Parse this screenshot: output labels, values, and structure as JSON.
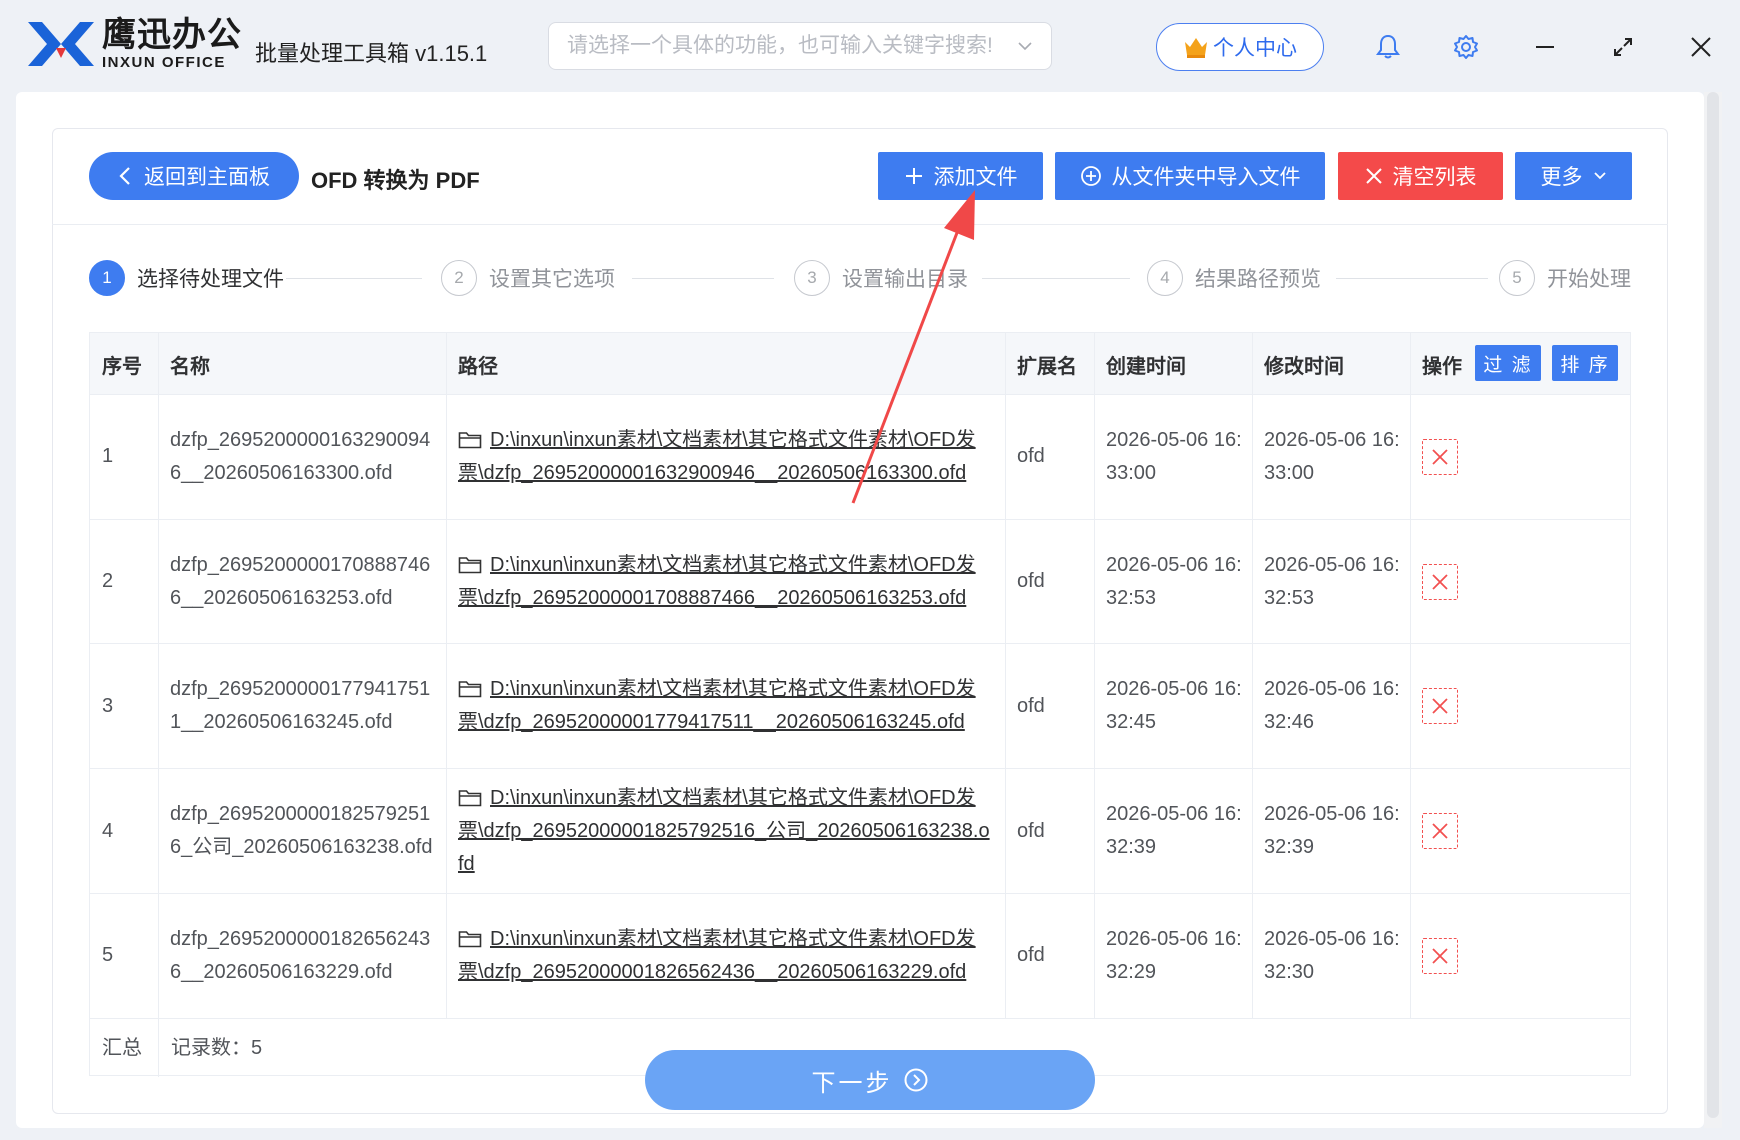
{
  "app": {
    "brand_cn": "鹰迅办公",
    "brand_en": "INXUN OFFICE",
    "title": "批量处理工具箱 v1.15.1",
    "search_placeholder": "请选择一个具体的功能，也可输入关键字搜索!",
    "user_center": "个人中心"
  },
  "toolbar": {
    "back_label": "返回到主面板",
    "page_title": "OFD 转换为 PDF",
    "add_file": "添加文件",
    "import_folder": "从文件夹中导入文件",
    "clear_list": "清空列表",
    "more": "更多"
  },
  "steps": [
    {
      "num": "1",
      "label": "选择待处理文件"
    },
    {
      "num": "2",
      "label": "设置其它选项"
    },
    {
      "num": "3",
      "label": "设置输出目录"
    },
    {
      "num": "4",
      "label": "结果路径预览"
    },
    {
      "num": "5",
      "label": "开始处理"
    }
  ],
  "table": {
    "headers": [
      "序号",
      "名称",
      "路径",
      "扩展名",
      "创建时间",
      "修改时间",
      "操作"
    ],
    "filter_label": "过 滤",
    "sort_label": "排 序",
    "rows": [
      {
        "index": "1",
        "name": "dzfp_26952000001632900946__20260506163300.ofd",
        "path": "D:\\inxun\\inxun素材\\文档素材\\其它格式文件素材\\OFD发票\\dzfp_26952000001632900946__20260506163300.ofd",
        "ext": "ofd",
        "created": "2026-05-06 16:33:00",
        "modified": "2026-05-06 16:33:00"
      },
      {
        "index": "2",
        "name": "dzfp_26952000001708887466__20260506163253.ofd",
        "path": "D:\\inxun\\inxun素材\\文档素材\\其它格式文件素材\\OFD发票\\dzfp_26952000001708887466__20260506163253.ofd",
        "ext": "ofd",
        "created": "2026-05-06 16:32:53",
        "modified": "2026-05-06 16:32:53"
      },
      {
        "index": "3",
        "name": "dzfp_26952000001779417511__20260506163245.ofd",
        "path": "D:\\inxun\\inxun素材\\文档素材\\其它格式文件素材\\OFD发票\\dzfp_26952000001779417511__20260506163245.ofd",
        "ext": "ofd",
        "created": "2026-05-06 16:32:45",
        "modified": "2026-05-06 16:32:46"
      },
      {
        "index": "4",
        "name": "dzfp_26952000001825792516_公司_20260506163238.ofd",
        "path": "D:\\inxun\\inxun素材\\文档素材\\其它格式文件素材\\OFD发票\\dzfp_26952000001825792516_公司_20260506163238.ofd",
        "ext": "ofd",
        "created": "2026-05-06 16:32:39",
        "modified": "2026-05-06 16:32:39"
      },
      {
        "index": "5",
        "name": "dzfp_26952000001826562436__20260506163229.ofd",
        "path": "D:\\inxun\\inxun素材\\文档素材\\其它格式文件素材\\OFD发票\\dzfp_26952000001826562436__20260506163229.ofd",
        "ext": "ofd",
        "created": "2026-05-06 16:32:29",
        "modified": "2026-05-06 16:32:30"
      }
    ],
    "summary_label": "汇总",
    "summary_count": "记录数：5"
  },
  "footer": {
    "next_label": "下一步"
  },
  "colors": {
    "primary": "#3e7cf0",
    "danger": "#f44a4a",
    "next_button": "#6aa4f5",
    "annotation_arrow": "#f04848"
  }
}
